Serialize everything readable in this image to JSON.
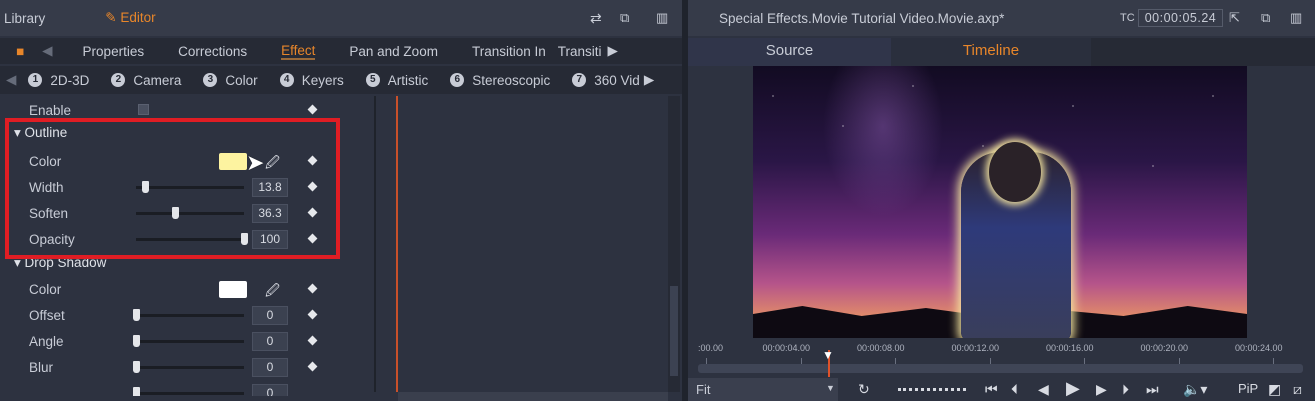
{
  "left": {
    "library_label": "Library",
    "editor_label": "Editor",
    "tabs": [
      "Properties",
      "Corrections",
      "Effect",
      "Pan and Zoom",
      "Transition In",
      "Transiti"
    ],
    "active_tab": "Effect",
    "categories": [
      {
        "n": "1",
        "label": "2D-3D"
      },
      {
        "n": "2",
        "label": "Camera"
      },
      {
        "n": "3",
        "label": "Color"
      },
      {
        "n": "4",
        "label": "Keyers"
      },
      {
        "n": "5",
        "label": "Artistic"
      },
      {
        "n": "6",
        "label": "Stereoscopic"
      },
      {
        "n": "7",
        "label": "360 Vid"
      }
    ],
    "enable_label": "Enable",
    "outline": {
      "title": "Outline",
      "color_label": "Color",
      "color": "#fdf3a0",
      "width_label": "Width",
      "width": "13.8",
      "width_pct": 8,
      "soften_label": "Soften",
      "soften": "36.3",
      "soften_pct": 36,
      "opacity_label": "Opacity",
      "opacity": "100",
      "opacity_pct": 100
    },
    "drop_shadow": {
      "title": "Drop Shadow",
      "color_label": "Color",
      "color": "#ffffff",
      "offset_label": "Offset",
      "offset": "0",
      "angle_label": "Angle",
      "angle": "0",
      "blur_label": "Blur",
      "blur": "0",
      "opacity_value": "0"
    }
  },
  "right": {
    "title": "Special Effects.Movie Tutorial Video.Movie.axp*",
    "tc_label": "TC",
    "timecode": "00:00:05.24",
    "tabs": [
      "Source",
      "Timeline"
    ],
    "active_tab": "Timeline",
    "ruler": [
      ":00.00",
      "00:00:04.00",
      "00:00:08.00",
      "00:00:12.00",
      "00:00:16.00",
      "00:00:20.00",
      "00:00:24.00"
    ],
    "zoom_select": "Fit",
    "pip_label": "PiP"
  },
  "colors": {
    "accent": "#e8862a",
    "highlight_box": "#e01d24",
    "playhead": "#e0522a"
  }
}
